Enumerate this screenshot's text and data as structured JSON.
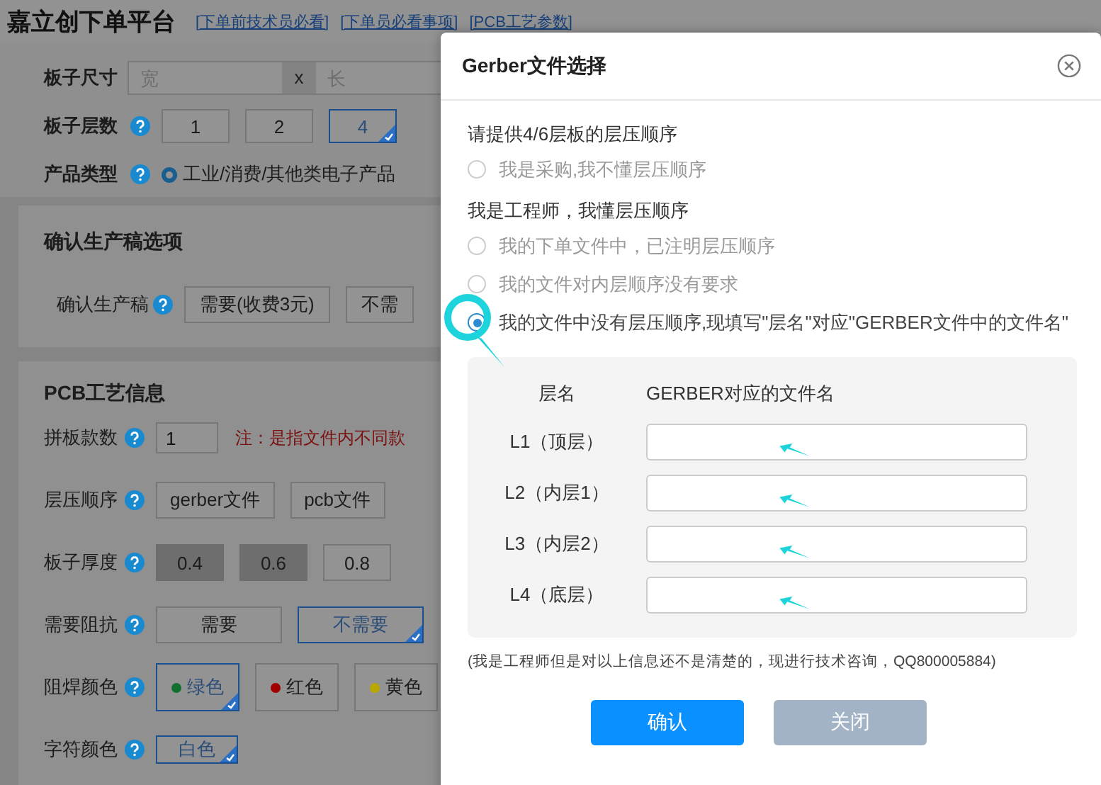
{
  "header": {
    "title": "嘉立创下单平台",
    "links": [
      "[下单前技术员必看]",
      "[下单员必看事项]",
      "[PCB工艺参数]"
    ]
  },
  "size_row": {
    "label": "板子尺寸",
    "width_placeholder": "宽",
    "separator": "x",
    "length_placeholder": "长"
  },
  "layers_row": {
    "label": "板子层数",
    "options": [
      {
        "label": "1",
        "selected": false
      },
      {
        "label": "2",
        "selected": false
      },
      {
        "label": "4",
        "selected": true
      }
    ]
  },
  "product_row": {
    "label": "产品类型",
    "options": [
      {
        "label": "工业/消费/其他类电子产品",
        "selected": true
      }
    ]
  },
  "confirm_section": {
    "title": "确认生产稿选项",
    "label": "确认生产稿",
    "options": [
      {
        "label": "需要(收费3元)",
        "selected": false
      },
      {
        "label": "不需",
        "selected": false
      }
    ]
  },
  "pcb_section": {
    "title": "PCB工艺信息",
    "rows": [
      {
        "kind": "input",
        "label": "拼板款数",
        "value": "1",
        "note": "注：是指文件内不同款"
      },
      {
        "kind": "options",
        "label": "层压顺序",
        "options": [
          {
            "label": "gerber文件",
            "selected": false,
            "disabled": false
          },
          {
            "label": "pcb文件",
            "selected": false,
            "disabled": false
          }
        ]
      },
      {
        "kind": "options",
        "label": "板子厚度",
        "options": [
          {
            "label": "0.4",
            "selected": false,
            "disabled": true
          },
          {
            "label": "0.6",
            "selected": false,
            "disabled": true
          },
          {
            "label": "0.8",
            "selected": false,
            "disabled": false
          }
        ]
      },
      {
        "kind": "options",
        "label": "需要阻抗",
        "options": [
          {
            "label": "需要",
            "selected": false,
            "disabled": false
          },
          {
            "label": "不需要",
            "selected": true,
            "disabled": false
          }
        ]
      },
      {
        "kind": "colors",
        "label": "阻焊颜色",
        "options": [
          {
            "label": "绿色",
            "selected": true,
            "color": "#12702f"
          },
          {
            "label": "红色",
            "selected": false,
            "color": "#a00000"
          },
          {
            "label": "黄色",
            "selected": false,
            "color": "#b8a800"
          }
        ]
      },
      {
        "kind": "options",
        "label": "字符颜色",
        "options": [
          {
            "label": "白色",
            "selected": true,
            "disabled": false
          }
        ]
      }
    ]
  },
  "dialog": {
    "title": "Gerber文件选择",
    "groups": [
      {
        "heading": "请提供4/6层板的层压顺序",
        "options": [
          {
            "label": "我是采购,我不懂层压顺序",
            "selected": false
          }
        ]
      },
      {
        "heading": "我是工程师，我懂层压顺序",
        "options": [
          {
            "label": "我的下单文件中，已注明层压顺序",
            "selected": false
          },
          {
            "label": "我的文件对内层顺序没有要求",
            "selected": false
          },
          {
            "label": "我的文件中没有层压顺序,现填写\"层名\"对应\"GERBER文件中的文件名\"",
            "selected": true
          }
        ]
      }
    ],
    "table": {
      "columns": [
        "层名",
        "GERBER对应的文件名"
      ],
      "rows": [
        {
          "layer": "L1（顶层）",
          "value": ""
        },
        {
          "layer": "L2（内层1）",
          "value": ""
        },
        {
          "layer": "L3（内层2）",
          "value": ""
        },
        {
          "layer": "L4（底层）",
          "value": ""
        }
      ]
    },
    "note": "(我是工程师但是对以上信息还不是清楚的，现进行技术咨询，QQ800005884)",
    "buttons": [
      {
        "label": "确认",
        "kind": "primary"
      },
      {
        "label": "关闭",
        "kind": "secondary"
      }
    ]
  }
}
